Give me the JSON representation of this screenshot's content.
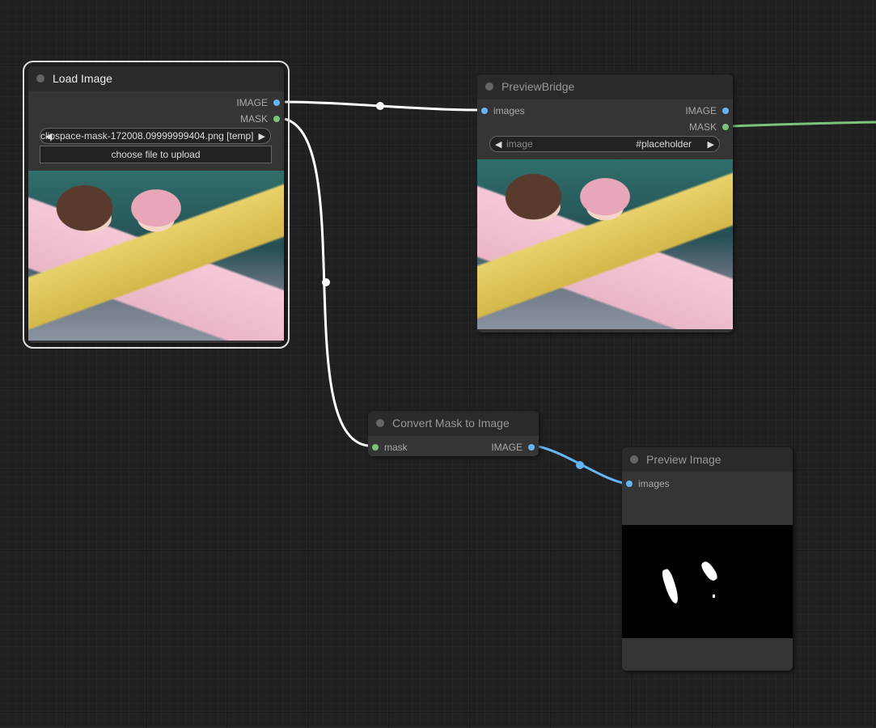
{
  "nodes": {
    "load_image": {
      "title": "Load Image",
      "outputs": [
        "IMAGE",
        "MASK"
      ],
      "image_combo_value": "clipspace-mask-172008.09999999404.png [temp]",
      "upload_label": "choose file to upload"
    },
    "preview_bridge": {
      "title": "PreviewBridge",
      "inputs": [
        "images"
      ],
      "outputs": [
        "IMAGE",
        "MASK"
      ],
      "combo_label": "image",
      "combo_value": "#placeholder"
    },
    "convert_mask": {
      "title": "Convert Mask to Image",
      "inputs": [
        "mask"
      ],
      "outputs": [
        "IMAGE"
      ]
    },
    "preview_image": {
      "title": "Preview Image",
      "inputs": [
        "images"
      ]
    }
  },
  "colors": {
    "image_link": "#ffffff",
    "mask_link": "#7cc47c",
    "image_link_blue": "#64b5f6"
  }
}
